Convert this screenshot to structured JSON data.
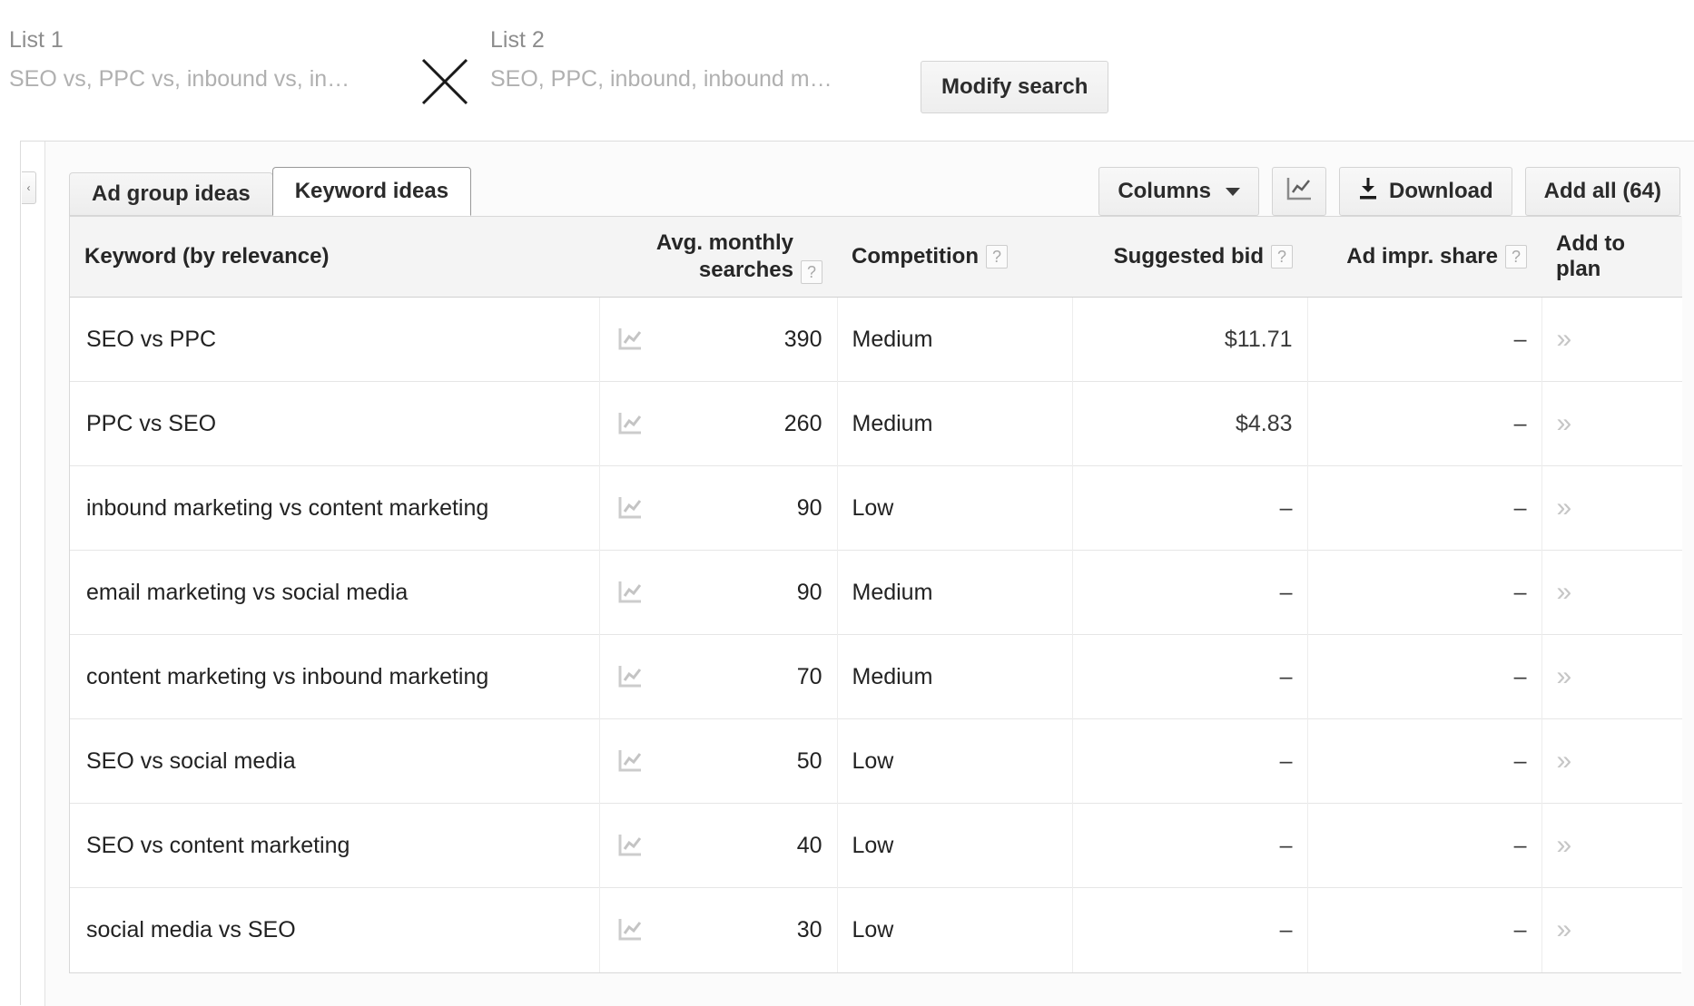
{
  "search_summary": {
    "list1": {
      "label": "List 1",
      "value": "SEO vs, PPC vs, inbound vs, in…"
    },
    "list2": {
      "label": "List 2",
      "value": "SEO, PPC, inbound, inbound m…"
    },
    "cross_icon": "multiply-icon",
    "modify_button": "Modify search"
  },
  "panel": {
    "collapse_handle": "‹",
    "tabs": [
      {
        "label": "Ad group ideas",
        "active": false
      },
      {
        "label": "Keyword ideas",
        "active": true
      }
    ],
    "toolbar": {
      "columns_label": "Columns",
      "columns_caret": "chevron-down-icon",
      "chart_icon": "line-chart-icon",
      "download_icon": "download-icon",
      "download_label": "Download",
      "add_all_label": "Add all (64)"
    }
  },
  "table": {
    "columns": [
      {
        "key": "keyword",
        "label": "Keyword (by relevance)",
        "help": false
      },
      {
        "key": "searches",
        "label": "Avg. monthly searches",
        "label_line1": "Avg. monthly",
        "label_line2": "searches",
        "help": true
      },
      {
        "key": "comp",
        "label": "Competition",
        "help": true
      },
      {
        "key": "bid",
        "label": "Suggested bid",
        "help": true
      },
      {
        "key": "share",
        "label": "Ad impr. share",
        "help": true
      },
      {
        "key": "add",
        "label": "Add to plan",
        "help": false
      }
    ],
    "help_glyph": "?",
    "add_glyph": "»",
    "spark_icon": "sparkline-chart-icon",
    "rows": [
      {
        "keyword": "SEO vs PPC",
        "searches": "390",
        "comp": "Medium",
        "bid": "$11.71",
        "share": "–",
        "add": "»"
      },
      {
        "keyword": "PPC vs SEO",
        "searches": "260",
        "comp": "Medium",
        "bid": "$4.83",
        "share": "–",
        "add": "»"
      },
      {
        "keyword": "inbound marketing vs content marketing",
        "searches": "90",
        "comp": "Low",
        "bid": "–",
        "share": "–",
        "add": "»"
      },
      {
        "keyword": "email marketing vs social media",
        "searches": "90",
        "comp": "Medium",
        "bid": "–",
        "share": "–",
        "add": "»"
      },
      {
        "keyword": "content marketing vs inbound marketing",
        "searches": "70",
        "comp": "Medium",
        "bid": "–",
        "share": "–",
        "add": "»"
      },
      {
        "keyword": "SEO vs social media",
        "searches": "50",
        "comp": "Low",
        "bid": "–",
        "share": "–",
        "add": "»"
      },
      {
        "keyword": "SEO vs content marketing",
        "searches": "40",
        "comp": "Low",
        "bid": "–",
        "share": "–",
        "add": "»"
      },
      {
        "keyword": "social media vs SEO",
        "searches": "30",
        "comp": "Low",
        "bid": "–",
        "share": "–",
        "add": "»"
      }
    ]
  },
  "colors": {
    "page_bg": "#ffffff",
    "panel_bg": "#fbfbfb",
    "header_row_bg": "#f4f4f4",
    "text": "#222222",
    "muted_text": "#b0b0b0",
    "border": "#d8d8d8"
  }
}
